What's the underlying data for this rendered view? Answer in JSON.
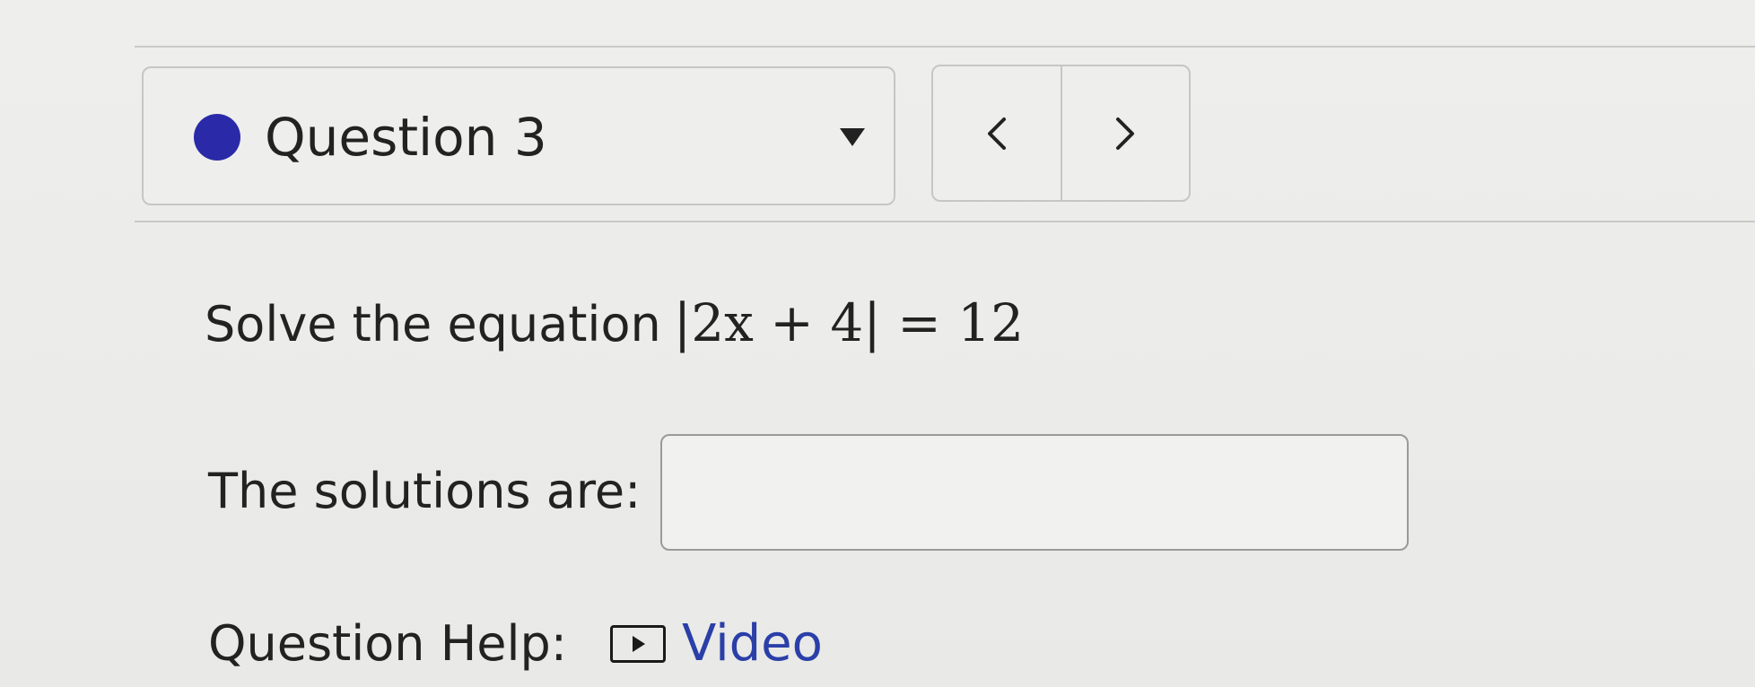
{
  "question_selector": {
    "label": "Question 3",
    "status_color": "#2a2aa8",
    "caret_icon": "caret-down-icon"
  },
  "navigation": {
    "prev_icon": "chevron-left-icon",
    "next_icon": "chevron-right-icon"
  },
  "problem": {
    "prompt": "Solve the equation",
    "equation": "|2x + 4| = 12"
  },
  "answer": {
    "label": "The solutions are:",
    "value": ""
  },
  "help": {
    "label": "Question Help:",
    "video_icon": "video-play-icon",
    "video_label": "Video",
    "link_color": "#2a3fa8"
  }
}
